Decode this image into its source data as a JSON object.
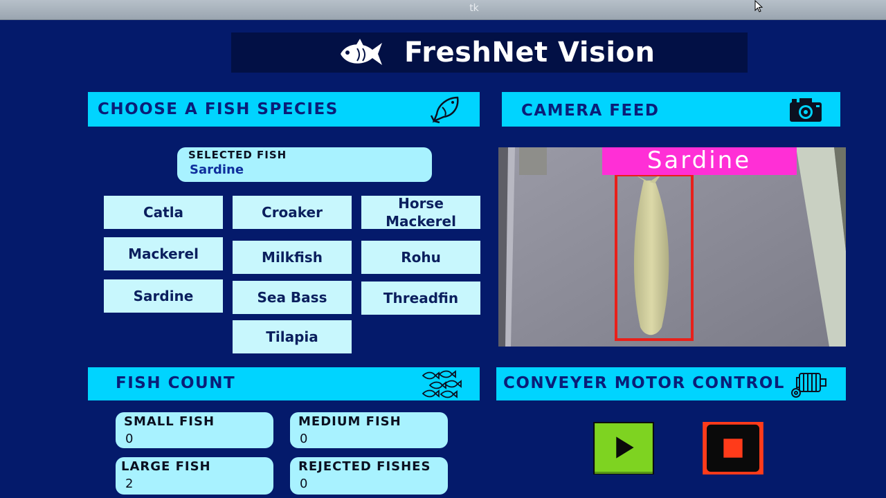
{
  "window": {
    "title": "tk"
  },
  "header": {
    "title": "FreshNet Vision",
    "logo_icon": "fish-logo-icon"
  },
  "species_panel": {
    "title": "CHOOSE A FISH SPECIES",
    "icon": "fish-outline-icon",
    "selected_label": "SELECTED  FISH",
    "selected_value": "Sardine",
    "buttons": [
      "Catla",
      "Croaker",
      "Horse Mackerel",
      "Mackerel",
      "Milkfish",
      "Rohu",
      "Sardine",
      "Sea Bass",
      "Threadfin",
      "Tilapia"
    ]
  },
  "camera_panel": {
    "title": "CAMERA FEED",
    "icon": "camera-icon",
    "detection_label": "Sardine"
  },
  "count_panel": {
    "title": "FISH COUNT",
    "icon": "fish-school-icon",
    "cards": [
      {
        "label": "SMALL FISH",
        "value": "0"
      },
      {
        "label": "MEDIUM FISH",
        "value": "0"
      },
      {
        "label": "LARGE FISH",
        "value": "2"
      },
      {
        "label": "REJECTED FISHES",
        "value": "0"
      }
    ]
  },
  "motor_panel": {
    "title": "CONVEYER MOTOR CONTROL",
    "icon": "motor-icon",
    "start_icon": "play-icon",
    "stop_icon": "stop-icon"
  },
  "colors": {
    "background": "#041a6b",
    "header_bg": "#021045",
    "section_bar": "#00d4ff",
    "card_bg": "#a8f2ff",
    "button_bg": "#c8f7fd",
    "detection_label_bg": "#ff2fd6",
    "bounding_box": "#e8201a",
    "play_button": "#7ed321",
    "stop_button": "#ff3b1a"
  }
}
